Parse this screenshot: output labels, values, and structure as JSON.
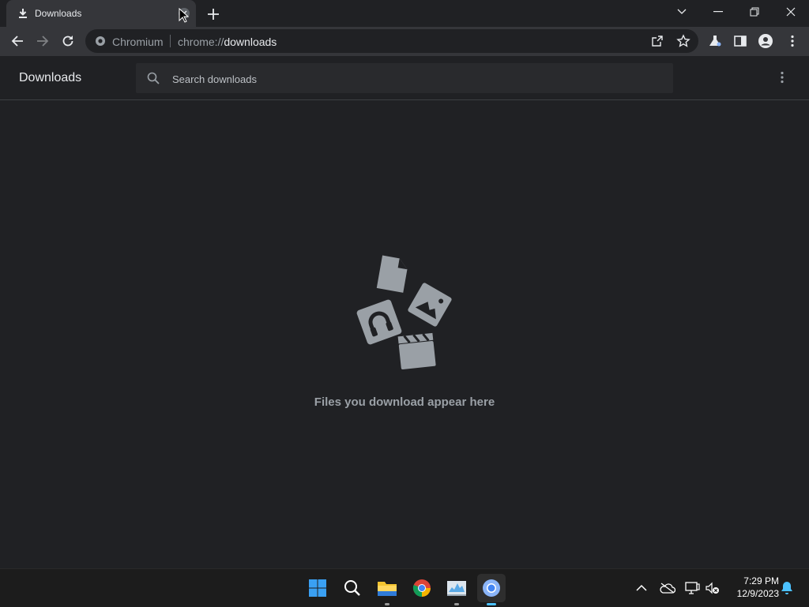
{
  "browser": {
    "tab": {
      "title": "Downloads",
      "icon": "download-icon"
    },
    "window_controls": [
      "tab-search-icon",
      "minimize-icon",
      "restore-icon",
      "close-icon"
    ]
  },
  "toolbar": {
    "site_name": "Chromium",
    "url_scheme": "chrome://",
    "url_host": "downloads"
  },
  "downloads": {
    "title": "Downloads",
    "search": {
      "placeholder": "Search downloads",
      "value": ""
    },
    "empty_message": "Files you download appear here"
  },
  "taskbar": {
    "apps": [
      "start",
      "search",
      "file-explorer",
      "chrome",
      "resource-monitor",
      "chromium"
    ],
    "clock": {
      "time": "7:29 PM",
      "date": "12/9/2023"
    }
  },
  "colors": {
    "background": "#202124",
    "toolbar": "#35363a",
    "search_box": "#292a2d",
    "empty_text": "#9aa0a6",
    "illustration": "#9aa0a6",
    "accent": "#4cc2ff"
  }
}
